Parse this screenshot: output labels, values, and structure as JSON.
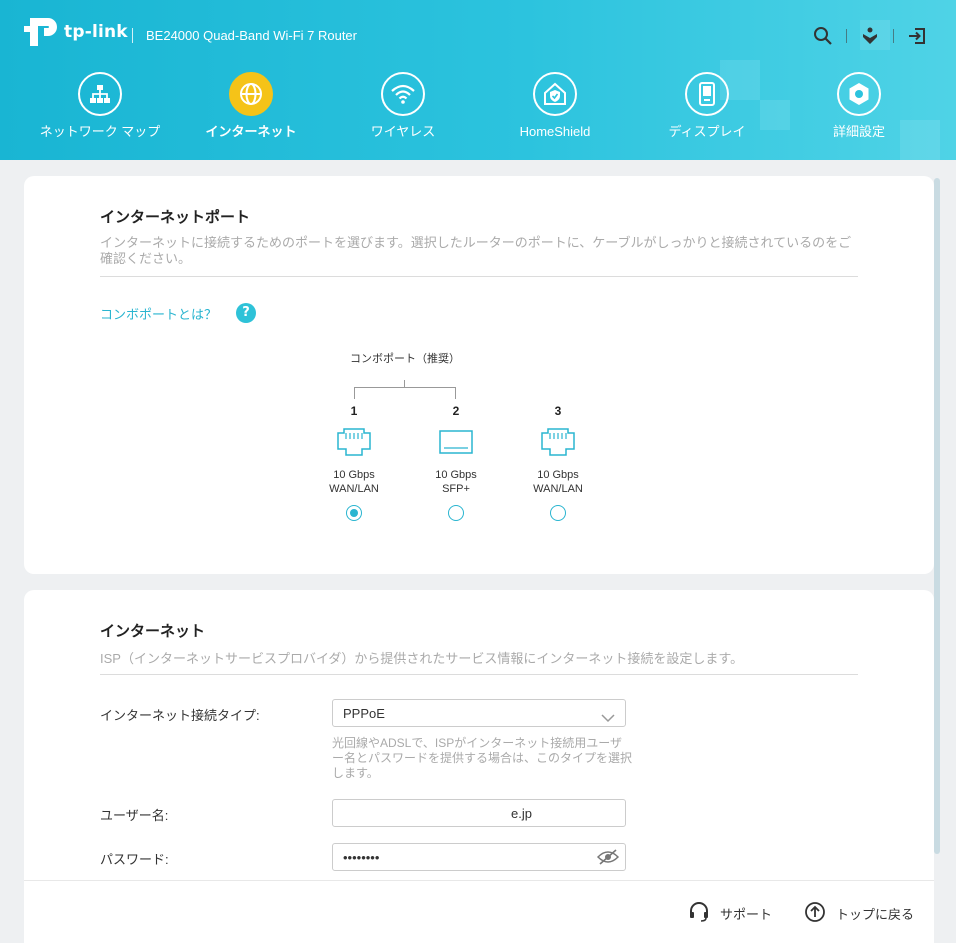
{
  "header": {
    "brand": "tp-link",
    "model": "BE24000 Quad-Band Wi-Fi 7 Router",
    "icons": [
      "search-icon",
      "account-icon",
      "logout-icon"
    ],
    "accent": "#f5c318",
    "background": "#19b5d3"
  },
  "nav": {
    "items": [
      {
        "label": "ネットワーク マップ",
        "icon": "network-map-icon",
        "active": false
      },
      {
        "label": "インターネット",
        "icon": "globe-icon",
        "active": true
      },
      {
        "label": "ワイヤレス",
        "icon": "wifi-icon",
        "active": false
      },
      {
        "label": "HomeShield",
        "icon": "homeshield-icon",
        "active": false
      },
      {
        "label": "ディスプレイ",
        "icon": "display-icon",
        "active": false
      },
      {
        "label": "詳細設定",
        "icon": "gear-icon",
        "active": false
      }
    ]
  },
  "internet_port": {
    "title": "インターネットポート",
    "description": "インターネットに接続するためのポートを選びます。選択したルーターのポートに、ケーブルがしっかりと接続されているのをご確認ください。",
    "combo_link": "コンボポートとは？",
    "help_icon": "?",
    "combo_label": "コンボポート（推奨）",
    "ports": [
      {
        "number": "1",
        "speed": "10 Gbps",
        "type": "WAN/LAN",
        "icon": "ethernet-port-icon",
        "selected": true
      },
      {
        "number": "2",
        "speed": "10 Gbps",
        "type": "SFP+",
        "icon": "sfp-port-icon",
        "selected": false
      },
      {
        "number": "3",
        "speed": "10 Gbps",
        "type": "WAN/LAN",
        "icon": "ethernet-port-icon",
        "selected": false
      }
    ]
  },
  "internet": {
    "title": "インターネット",
    "description": "ISP（インターネットサービスプロバイダ）から提供されたサービス情報にインターネット接続を設定します。",
    "connection_type_label": "インターネット接続タイプ:",
    "connection_type_value": "PPPoE",
    "connection_type_hint": "光回線やADSLで、ISPがインターネット接続用ユーザー名とパスワードを提供する場合は、このタイプを選択します。",
    "username_label": "ユーザー名:",
    "username_value": "e.jp",
    "password_label": "パスワード:",
    "password_value": "••••••••"
  },
  "footer": {
    "support_label": "サポート",
    "back_to_top_label": "トップに戻る"
  }
}
